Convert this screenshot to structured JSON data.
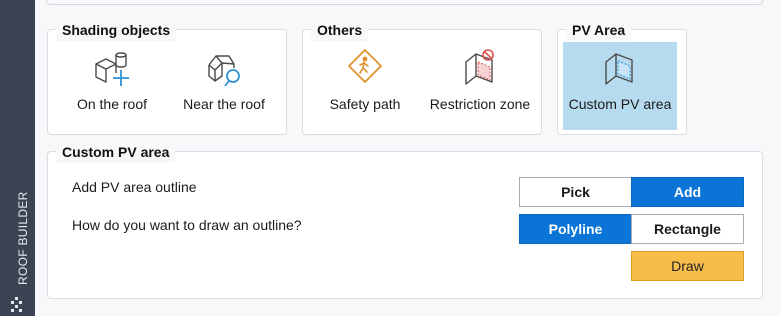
{
  "sidebar": {
    "label": "ROOF BUILDER"
  },
  "groups": {
    "shading": {
      "title": "Shading objects",
      "items": [
        {
          "label": "On the roof",
          "icon": "box-cylinder-plus-icon"
        },
        {
          "label": "Near the roof",
          "icon": "house-magnifier-icon"
        }
      ]
    },
    "others": {
      "title": "Others",
      "items": [
        {
          "label": "Safety path",
          "icon": "walking-person-sign-icon"
        },
        {
          "label": "Restriction zone",
          "icon": "no-entry-zone-icon"
        }
      ]
    },
    "pv_area": {
      "title": "PV Area",
      "items": [
        {
          "label": "Custom PV area",
          "icon": "pv-area-icon",
          "selected": true
        }
      ]
    }
  },
  "custom_pv": {
    "title": "Custom PV area",
    "outline_label": "Add PV area outline",
    "pick_label": "Pick",
    "add_label": "Add",
    "draw_question": "How do you want to draw an outline?",
    "polyline_label": "Polyline",
    "rectangle_label": "Rectangle",
    "draw_label": "Draw",
    "active_outline_mode": "Add",
    "active_draw_mode": "Polyline"
  },
  "colors": {
    "primary": "#0a75d6",
    "selected_bg": "#b7dbee",
    "draw_button": "#f7bd4a",
    "sidebar": "#3b4453",
    "icon_orange": "#e0932c",
    "icon_blue": "#2f92d4",
    "icon_red": "#d9534f"
  }
}
